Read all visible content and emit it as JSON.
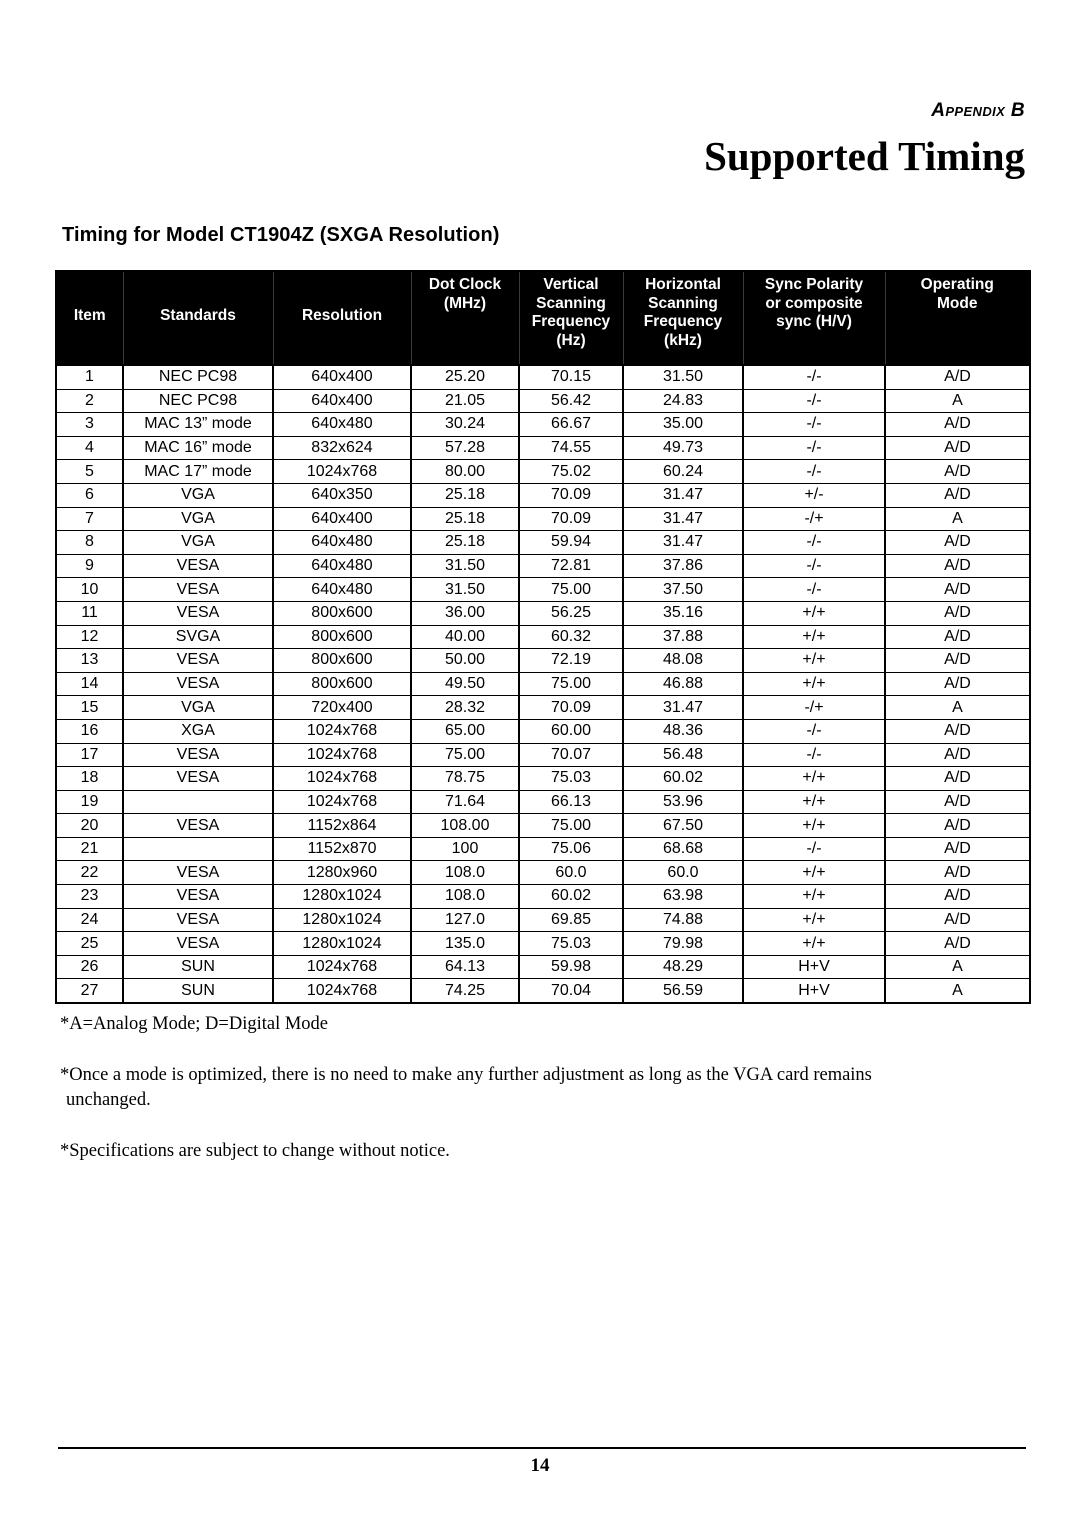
{
  "header": {
    "appendix_label": "Appendix B",
    "title": "Supported Timing"
  },
  "subtitle": "Timing for Model CT1904Z (SXGA Resolution)",
  "table": {
    "columns": [
      {
        "key": "item",
        "label_lines": [
          "Item"
        ]
      },
      {
        "key": "standards",
        "label_lines": [
          "Standards"
        ]
      },
      {
        "key": "resolution",
        "label_lines": [
          "Resolution"
        ]
      },
      {
        "key": "dot_clock",
        "label_lines": [
          "Dot Clock",
          "(MHz)"
        ]
      },
      {
        "key": "vertical",
        "label_lines": [
          "Vertical",
          "Scanning",
          "Frequency",
          "(Hz)"
        ]
      },
      {
        "key": "horizontal",
        "label_lines": [
          "Horizontal",
          "Scanning",
          "Frequency",
          "(kHz)"
        ]
      },
      {
        "key": "sync",
        "label_lines": [
          "Sync Polarity",
          "or composite",
          "sync (H/V)"
        ]
      },
      {
        "key": "mode",
        "label_lines": [
          "Operating",
          "Mode"
        ]
      }
    ],
    "headers": {
      "item": "Item",
      "standards": "Standards",
      "resolution": "Resolution",
      "dot_clock_l1": "Dot Clock",
      "dot_clock_l2": "(MHz)",
      "vertical_l1": "Vertical",
      "vertical_l2": "Scanning",
      "vertical_l3": "Frequency",
      "vertical_l4": "(Hz)",
      "horizontal_l1": "Horizontal",
      "horizontal_l2": "Scanning",
      "horizontal_l3": "Frequency",
      "horizontal_l4": "(kHz)",
      "sync_l1": "Sync Polarity",
      "sync_l2": "or composite",
      "sync_l3": "sync (H/V)",
      "mode_l1": "Operating",
      "mode_l2": "Mode"
    },
    "rows": [
      {
        "item": "1",
        "standards": "NEC PC98",
        "resolution": "640x400",
        "dot_clock": "25.20",
        "vertical": "70.15",
        "horizontal": "31.50",
        "sync": "-/-",
        "mode": "A/D"
      },
      {
        "item": "2",
        "standards": "NEC PC98",
        "resolution": "640x400",
        "dot_clock": "21.05",
        "vertical": "56.42",
        "horizontal": "24.83",
        "sync": "-/-",
        "mode": "A"
      },
      {
        "item": "3",
        "standards": "MAC 13” mode",
        "resolution": "640x480",
        "dot_clock": "30.24",
        "vertical": "66.67",
        "horizontal": "35.00",
        "sync": "-/-",
        "mode": "A/D"
      },
      {
        "item": "4",
        "standards": "MAC 16” mode",
        "resolution": "832x624",
        "dot_clock": "57.28",
        "vertical": "74.55",
        "horizontal": "49.73",
        "sync": "-/-",
        "mode": "A/D"
      },
      {
        "item": "5",
        "standards": "MAC 17” mode",
        "resolution": "1024x768",
        "dot_clock": "80.00",
        "vertical": "75.02",
        "horizontal": "60.24",
        "sync": "-/-",
        "mode": "A/D"
      },
      {
        "item": "6",
        "standards": "VGA",
        "resolution": "640x350",
        "dot_clock": "25.18",
        "vertical": "70.09",
        "horizontal": "31.47",
        "sync": "+/-",
        "mode": "A/D"
      },
      {
        "item": "7",
        "standards": "VGA",
        "resolution": "640x400",
        "dot_clock": "25.18",
        "vertical": "70.09",
        "horizontal": "31.47",
        "sync": "-/+",
        "mode": "A"
      },
      {
        "item": "8",
        "standards": "VGA",
        "resolution": "640x480",
        "dot_clock": "25.18",
        "vertical": "59.94",
        "horizontal": "31.47",
        "sync": "-/-",
        "mode": "A/D"
      },
      {
        "item": "9",
        "standards": "VESA",
        "resolution": "640x480",
        "dot_clock": "31.50",
        "vertical": "72.81",
        "horizontal": "37.86",
        "sync": "-/-",
        "mode": "A/D"
      },
      {
        "item": "10",
        "standards": "VESA",
        "resolution": "640x480",
        "dot_clock": "31.50",
        "vertical": "75.00",
        "horizontal": "37.50",
        "sync": "-/-",
        "mode": "A/D"
      },
      {
        "item": "11",
        "standards": "VESA",
        "resolution": "800x600",
        "dot_clock": "36.00",
        "vertical": "56.25",
        "horizontal": "35.16",
        "sync": "+/+",
        "mode": "A/D"
      },
      {
        "item": "12",
        "standards": "SVGA",
        "resolution": "800x600",
        "dot_clock": "40.00",
        "vertical": "60.32",
        "horizontal": "37.88",
        "sync": "+/+",
        "mode": "A/D"
      },
      {
        "item": "13",
        "standards": "VESA",
        "resolution": "800x600",
        "dot_clock": "50.00",
        "vertical": "72.19",
        "horizontal": "48.08",
        "sync": "+/+",
        "mode": "A/D"
      },
      {
        "item": "14",
        "standards": "VESA",
        "resolution": "800x600",
        "dot_clock": "49.50",
        "vertical": "75.00",
        "horizontal": "46.88",
        "sync": "+/+",
        "mode": "A/D"
      },
      {
        "item": "15",
        "standards": "VGA",
        "resolution": "720x400",
        "dot_clock": "28.32",
        "vertical": "70.09",
        "horizontal": "31.47",
        "sync": "-/+",
        "mode": "A"
      },
      {
        "item": "16",
        "standards": "XGA",
        "resolution": "1024x768",
        "dot_clock": "65.00",
        "vertical": "60.00",
        "horizontal": "48.36",
        "sync": "-/-",
        "mode": "A/D"
      },
      {
        "item": "17",
        "standards": "VESA",
        "resolution": "1024x768",
        "dot_clock": "75.00",
        "vertical": "70.07",
        "horizontal": "56.48",
        "sync": "-/-",
        "mode": "A/D"
      },
      {
        "item": "18",
        "standards": "VESA",
        "resolution": "1024x768",
        "dot_clock": "78.75",
        "vertical": "75.03",
        "horizontal": "60.02",
        "sync": "+/+",
        "mode": "A/D"
      },
      {
        "item": "19",
        "standards": "",
        "resolution": "1024x768",
        "dot_clock": "71.64",
        "vertical": "66.13",
        "horizontal": "53.96",
        "sync": "+/+",
        "mode": "A/D"
      },
      {
        "item": "20",
        "standards": "VESA",
        "resolution": "1152x864",
        "dot_clock": "108.00",
        "vertical": "75.00",
        "horizontal": "67.50",
        "sync": "+/+",
        "mode": "A/D"
      },
      {
        "item": "21",
        "standards": "",
        "resolution": "1152x870",
        "dot_clock": "100",
        "vertical": "75.06",
        "horizontal": "68.68",
        "sync": "-/-",
        "mode": "A/D"
      },
      {
        "item": "22",
        "standards": "VESA",
        "resolution": "1280x960",
        "dot_clock": "108.0",
        "vertical": "60.0",
        "horizontal": "60.0",
        "sync": "+/+",
        "mode": "A/D"
      },
      {
        "item": "23",
        "standards": "VESA",
        "resolution": "1280x1024",
        "dot_clock": "108.0",
        "vertical": "60.02",
        "horizontal": "63.98",
        "sync": "+/+",
        "mode": "A/D"
      },
      {
        "item": "24",
        "standards": "VESA",
        "resolution": "1280x1024",
        "dot_clock": "127.0",
        "vertical": "69.85",
        "horizontal": "74.88",
        "sync": "+/+",
        "mode": "A/D"
      },
      {
        "item": "25",
        "standards": "VESA",
        "resolution": "1280x1024",
        "dot_clock": "135.0",
        "vertical": "75.03",
        "horizontal": "79.98",
        "sync": "+/+",
        "mode": "A/D"
      },
      {
        "item": "26",
        "standards": "SUN",
        "resolution": "1024x768",
        "dot_clock": "64.13",
        "vertical": "59.98",
        "horizontal": "48.29",
        "sync": "H+V",
        "mode": "A"
      },
      {
        "item": "27",
        "standards": "SUN",
        "resolution": "1024x768",
        "dot_clock": "74.25",
        "vertical": "70.04",
        "horizontal": "56.59",
        "sync": "H+V",
        "mode": "A"
      }
    ]
  },
  "notes": {
    "note1": "*A=Analog Mode; D=Digital Mode",
    "note2_line1": "*Once a mode is optimized, there is no need to make any further adjustment as long as the VGA card remains",
    "note2_line2": "unchanged.",
    "note3": "*Specifications are subject to change without notice."
  },
  "footer": {
    "page_number": "14"
  }
}
